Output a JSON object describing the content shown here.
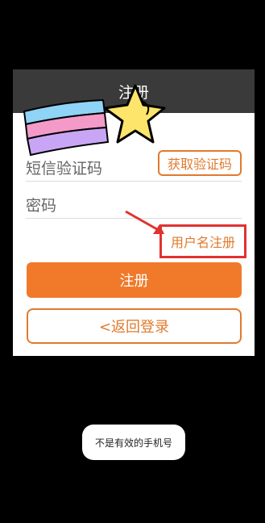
{
  "header": {
    "title": "注册"
  },
  "form": {
    "sms_code_placeholder": "短信验证码",
    "get_code_button": "获取验证码",
    "password_placeholder": "密码",
    "username_register_link": "用户名注册",
    "register_button": "注册",
    "back_to_login_button": "<返回登录"
  },
  "toast": {
    "message": "不是有效的手机号"
  },
  "colors": {
    "accent": "#f07a2a",
    "highlight": "#e0332f",
    "header": "#3a3a3a"
  }
}
